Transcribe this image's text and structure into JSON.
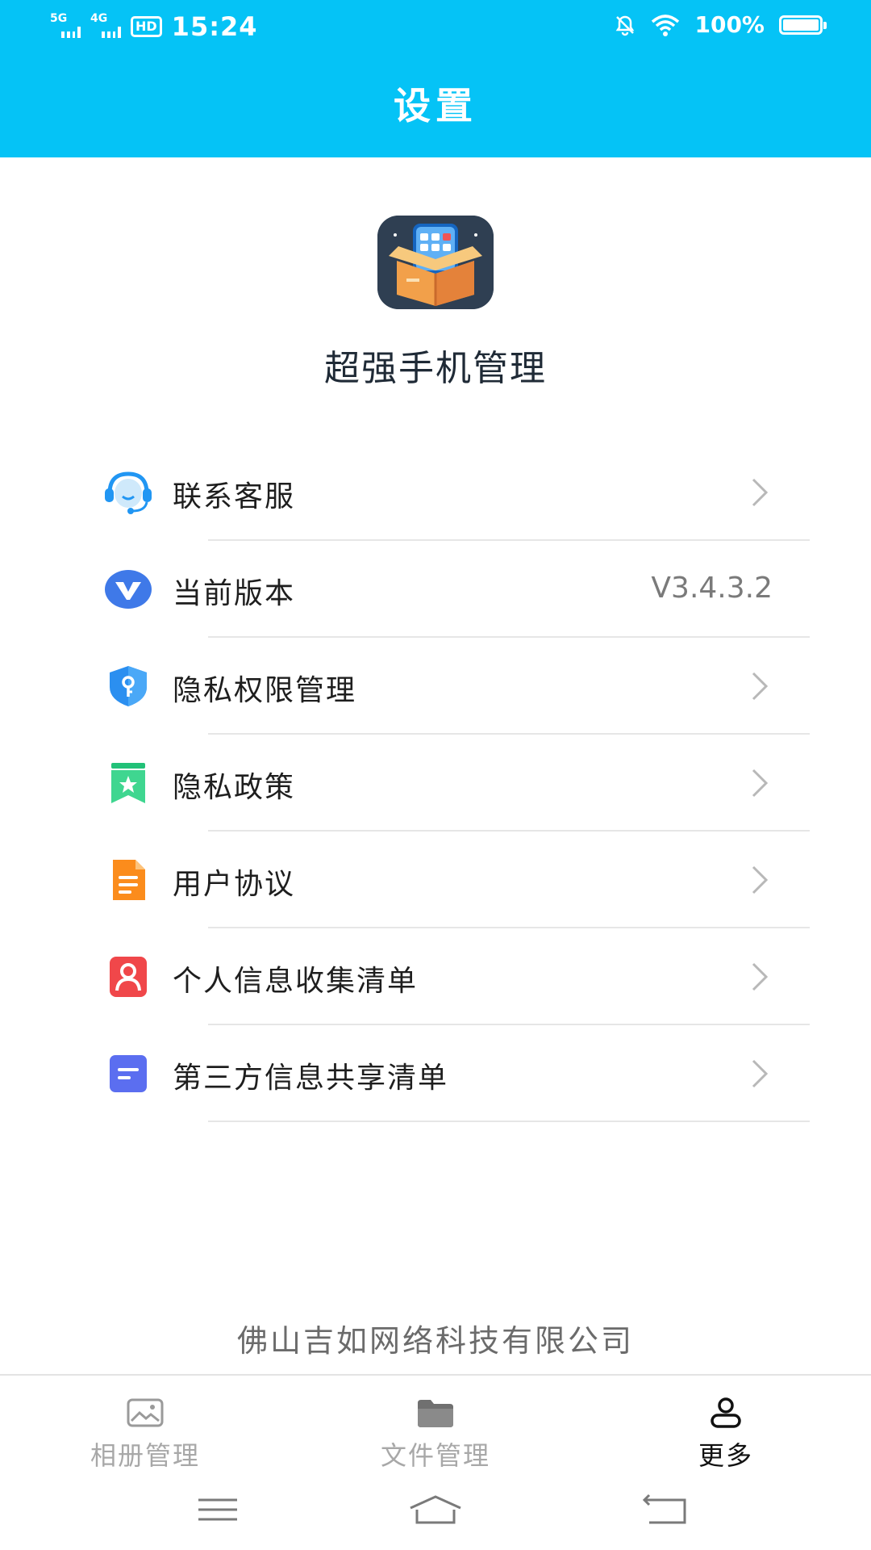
{
  "status_bar": {
    "signal1": "5G",
    "signal2": "4G",
    "hd": "HD",
    "time": "15:24",
    "battery": "100%"
  },
  "header": {
    "title": "设置"
  },
  "app": {
    "name": "超强手机管理",
    "logo_icon": "phone-box-logo-icon"
  },
  "settings": [
    {
      "label": "联系客服",
      "icon": "headset-icon",
      "value": ""
    },
    {
      "label": "当前版本",
      "icon": "version-v-icon",
      "value": "V3.4.3.2"
    },
    {
      "label": "隐私权限管理",
      "icon": "shield-key-icon",
      "value": ""
    },
    {
      "label": "隐私政策",
      "icon": "bookmark-star-icon",
      "value": ""
    },
    {
      "label": "用户协议",
      "icon": "document-icon",
      "value": ""
    },
    {
      "label": "个人信息收集清单",
      "icon": "person-card-icon",
      "value": ""
    },
    {
      "label": "第三方信息共享清单",
      "icon": "note-icon",
      "value": ""
    }
  ],
  "footer": {
    "company": "佛山吉如网络科技有限公司"
  },
  "tabs": [
    {
      "label": "相册管理",
      "icon": "photo-album-icon",
      "active": false
    },
    {
      "label": "文件管理",
      "icon": "folder-icon",
      "active": false
    },
    {
      "label": "更多",
      "icon": "user-icon",
      "active": true
    }
  ],
  "colors": {
    "header": "#05c3f6",
    "text": "#1e1e1e",
    "muted": "#a8a8a8",
    "divider": "#e6e6e6"
  }
}
